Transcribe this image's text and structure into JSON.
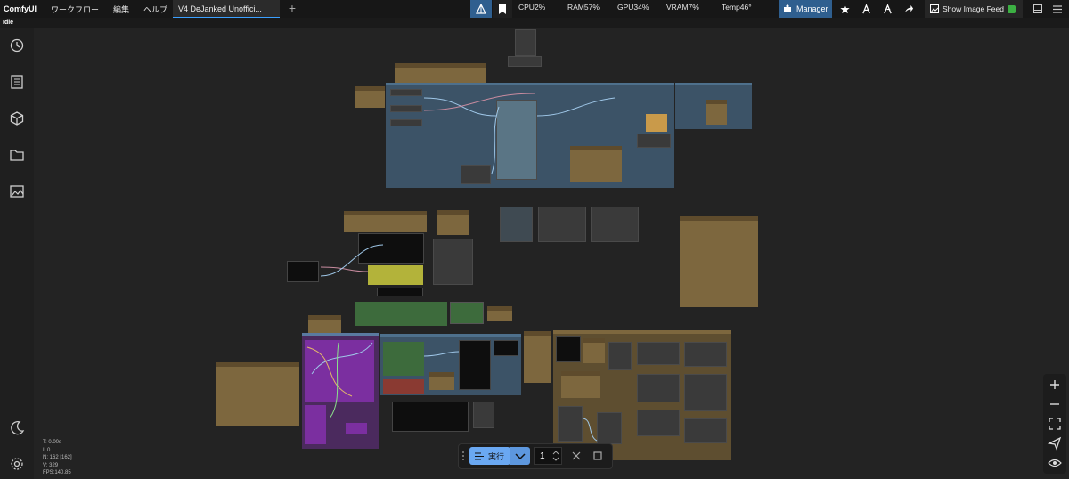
{
  "app": {
    "name": "ComfyUI"
  },
  "menu": [
    "ワークフロー",
    "編集",
    "ヘルプ"
  ],
  "tab": {
    "title": "V4 DeJanked Unoffici..."
  },
  "stats": {
    "cpu": "CPU2%",
    "ram": "RAM57%",
    "gpu": "GPU34%",
    "vram": "VRAM7%",
    "temp": "Temp46°"
  },
  "toolbar": {
    "manager_label": "Manager",
    "feed_label": "Show Image Feed"
  },
  "status_text": "Idle",
  "canvas_info": {
    "t": "T: 0.00s",
    "i": "I: 0",
    "n": "N: 162 [162]",
    "v": "V: 329",
    "fps": "FPS:140.85"
  },
  "runbar": {
    "run_label": "実行",
    "count": "1"
  },
  "colors": {
    "accent": "#3ba0ff",
    "run_button": "#6aa8f2",
    "group_brown": "#7d673e",
    "group_blue": "#3c5367",
    "group_purple": "#6d2a8a",
    "group_green": "#3d6b3c",
    "node_yellow": "#b3b33a"
  }
}
